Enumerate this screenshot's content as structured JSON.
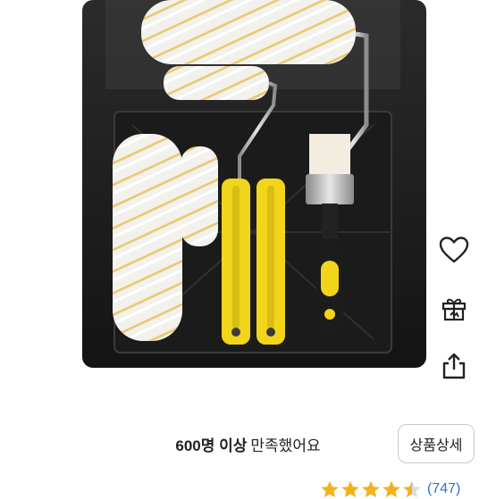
{
  "product": {
    "image_alt": "paint roller tray kit"
  },
  "side_actions": {
    "like_icon": "heart-outline-icon",
    "gift_icon": "gift-box-icon",
    "share_icon": "share-upload-icon"
  },
  "review": {
    "count_text": "600명 이상",
    "satisfied_text": "만족했어요",
    "detail_button": "상품상세"
  },
  "rating": {
    "stars": 4.5,
    "count_label": "(747)"
  },
  "colors": {
    "accent_blue": "#2f6fd6",
    "star_gold": "#f3b21c",
    "tray_black": "#1f1f1f",
    "handle_yellow": "#f2d51b"
  }
}
